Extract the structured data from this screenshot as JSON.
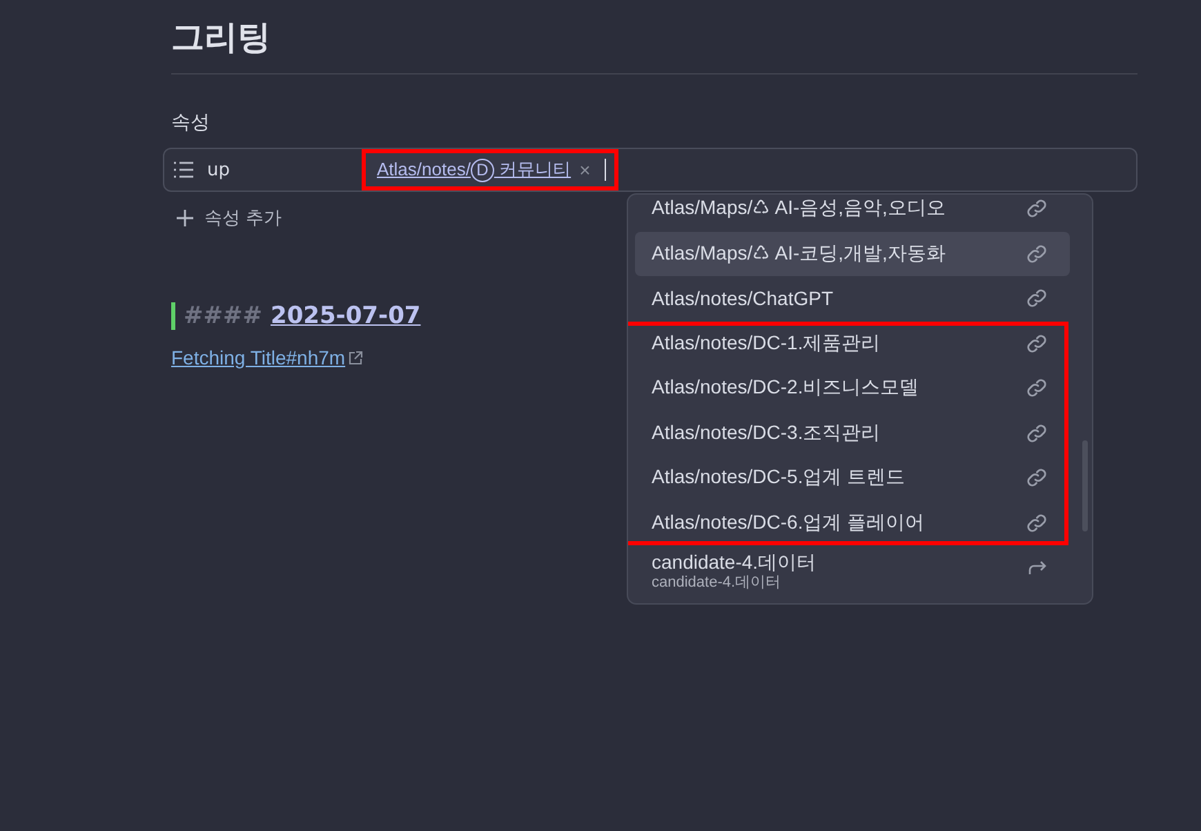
{
  "title": "그리팅",
  "properties": {
    "heading": "속성",
    "rows": [
      {
        "key": "up",
        "chips": [
          {
            "path": "Atlas/notes/",
            "badge": "D",
            "name": "커뮤니티",
            "remove": "×",
            "highlighted": true
          }
        ]
      }
    ],
    "add_label": "속성 추가"
  },
  "body": {
    "heading_marks": "####",
    "heading": "2025-07-07",
    "link": "Fetching Title#nh7m"
  },
  "suggestions": [
    {
      "kind": "link",
      "label": "Atlas/Maps/♺ AI-음성,음악,오디오",
      "selected": false,
      "highlighted": false
    },
    {
      "kind": "link",
      "label": "Atlas/Maps/♺ AI-코딩,개발,자동화",
      "selected": true,
      "highlighted": false
    },
    {
      "kind": "link",
      "label": "Atlas/notes/ChatGPT",
      "selected": false,
      "highlighted": false
    },
    {
      "kind": "link",
      "label": "Atlas/notes/DC-1.제품관리",
      "selected": false,
      "highlighted": true
    },
    {
      "kind": "link",
      "label": "Atlas/notes/DC-2.비즈니스모델",
      "selected": false,
      "highlighted": true
    },
    {
      "kind": "link",
      "label": "Atlas/notes/DC-3.조직관리",
      "selected": false,
      "highlighted": true
    },
    {
      "kind": "link",
      "label": "Atlas/notes/DC-5.업계 트렌드",
      "selected": false,
      "highlighted": true
    },
    {
      "kind": "link",
      "label": "Atlas/notes/DC-6.업계 플레이어",
      "selected": false,
      "highlighted": true
    },
    {
      "kind": "alias",
      "label": "candidate-4.데이터",
      "sub": "candidate-4.데이터",
      "selected": false,
      "highlighted": false
    }
  ]
}
